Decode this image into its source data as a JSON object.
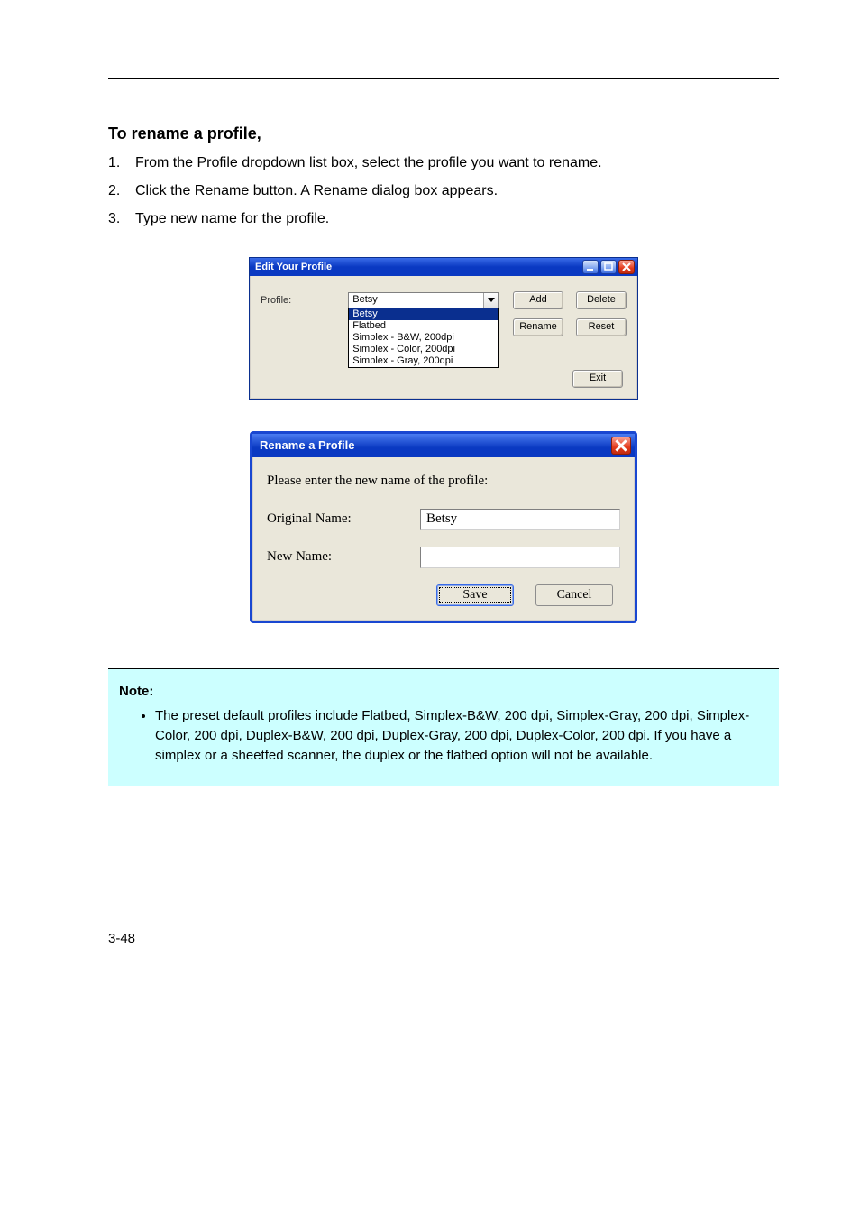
{
  "sections": {
    "rename_title": "To rename a profile,",
    "rename_steps": [
      "From the Profile dropdown list box, select the profile you want to rename.",
      "Click the Rename button. A Rename dialog box appears.",
      "Type new name for the profile."
    ]
  },
  "edit_dialog": {
    "title": "Edit Your Profile",
    "label": "Profile:",
    "combo_value": "Betsy",
    "options": [
      "Betsy",
      "Flatbed",
      "Simplex - B&W, 200dpi",
      "Simplex - Color, 200dpi",
      "Simplex - Gray, 200dpi"
    ],
    "buttons": {
      "add": "Add",
      "delete": "Delete",
      "rename": "Rename",
      "reset": "Reset",
      "exit": "Exit"
    }
  },
  "rename_dialog": {
    "title": "Rename a Profile",
    "prompt": "Please enter the new name of the profile:",
    "labels": {
      "original": "Original Name:",
      "new": "New Name:"
    },
    "original_value": "Betsy",
    "new_value": "",
    "buttons": {
      "save": "Save",
      "cancel": "Cancel"
    }
  },
  "note": {
    "label": "Note:",
    "items": [
      "The preset default profiles include Flatbed, Simplex-B&W, 200 dpi, Simplex-Gray, 200 dpi, Simplex-Color, 200 dpi, Duplex-B&W, 200 dpi, Duplex-Gray, 200 dpi, Duplex-Color, 200 dpi. If you have a simplex or a sheetfed scanner, the duplex or the flatbed option will not be available."
    ]
  },
  "footer": "3-48"
}
